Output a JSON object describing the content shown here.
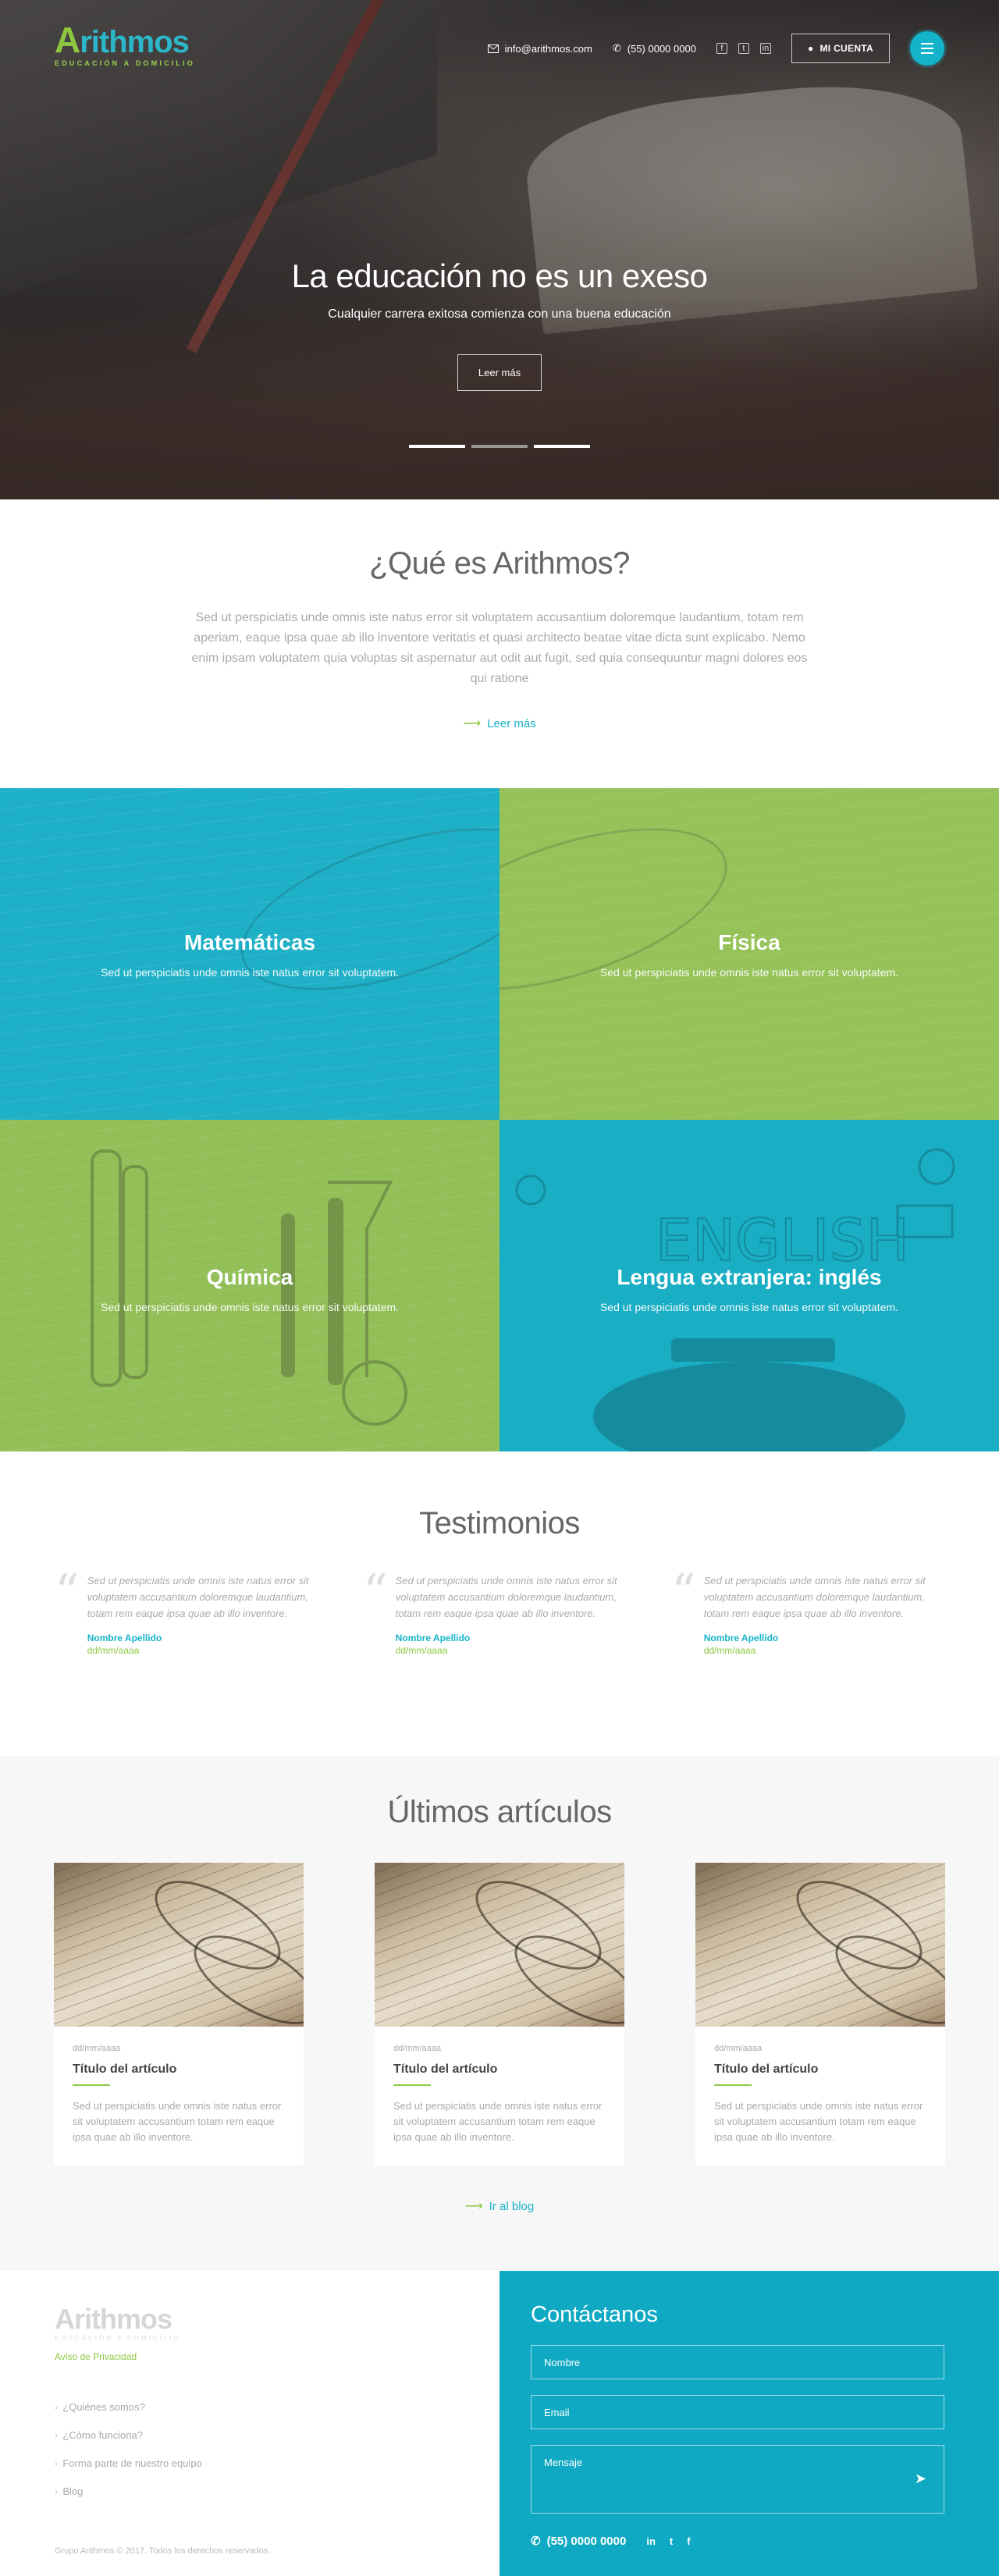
{
  "brand": {
    "logo_letter": "A",
    "logo_rest": "rithmos",
    "tagline": "EDUCACIÓN A DOMICILIO",
    "accent_teal": "#15b3c9",
    "accent_green": "#8dc63f"
  },
  "nav": {
    "email": "info@arithmos.com",
    "phone": "(55) 0000 0000",
    "account_label": "MI CUENTA",
    "social_icons": [
      "facebook-icon",
      "twitter-icon",
      "linkedin-icon"
    ]
  },
  "hero": {
    "title": "La educación no es un exeso",
    "subtitle": "Cualquier carrera exitosa comienza con una buena educación",
    "button_label": "Leer más",
    "slides_total": 3,
    "active_slide": 1
  },
  "about": {
    "title": "¿Qué es Arithmos?",
    "text": "Sed ut perspiciatis unde omnis iste natus error sit voluptatem accusantium doloremque laudantium, totam rem aperiam, eaque ipsa quae ab illo inventore veritatis et quasi architecto beatae vitae dicta sunt explicabo. Nemo enim ipsam voluptatem quia voluptas sit aspernatur aut odit aut fugit, sed quia consequuntur magni dolores eos qui ratione",
    "link_label": "Leer más"
  },
  "subjects": [
    {
      "title": "Matemáticas",
      "desc": "Sed ut perspiciatis unde omnis iste natus error sit voluptatem.",
      "color": "#1db0c7"
    },
    {
      "title": "Física",
      "desc": "Sed ut perspiciatis unde omnis iste natus error sit voluptatem.",
      "color": "#95c259"
    },
    {
      "title": "Química",
      "desc": "Sed ut perspiciatis unde omnis iste natus error sit voluptatem.",
      "color": "#95c259"
    },
    {
      "title": "Lengua extranjera: inglés",
      "desc": "Sed ut perspiciatis unde omnis iste natus error sit voluptatem.",
      "color": "#1db0c7"
    }
  ],
  "testimonials": {
    "title": "Testimonios",
    "items": [
      {
        "text": "Sed ut perspiciatis unde omnis iste natus error sit voluptatem accusantium doloremque laudantium, totam rem eaque ipsa quae ab illo inventore.",
        "name": "Nombre Apellido",
        "date": "dd/mm/aaaa"
      },
      {
        "text": "Sed ut perspiciatis unde omnis iste natus error sit voluptatem accusantium doloremque laudantium, totam rem eaque ipsa quae ab illo inventore.",
        "name": "Nombre Apellido",
        "date": "dd/mm/aaaa"
      },
      {
        "text": "Sed ut perspiciatis unde omnis iste natus error sit voluptatem accusantium doloremque laudantium, totam rem eaque ipsa quae ab illo inventore.",
        "name": "Nombre Apellido",
        "date": "dd/mm/aaaa"
      }
    ]
  },
  "articles": {
    "title": "Últimos artículos",
    "items": [
      {
        "date": "dd/mm/aaaa",
        "title": "Título del artículo",
        "text": "Sed ut perspiciatis unde omnis iste natus error sit voluptatem accusantium totam rem eaque ipsa quae ab illo inventore."
      },
      {
        "date": "dd/mm/aaaa",
        "title": "Título del artículo",
        "text": "Sed ut perspiciatis unde omnis iste natus error sit voluptatem accusantium totam rem eaque ipsa quae ab illo inventore."
      },
      {
        "date": "dd/mm/aaaa",
        "title": "Título del artículo",
        "text": "Sed ut perspiciatis unde omnis iste natus error sit voluptatem accusantium totam rem eaque ipsa quae ab illo inventore."
      }
    ],
    "blog_link": "Ir al blog"
  },
  "footer": {
    "logo": "Arithmos",
    "tagline": "EDUCACIÓN A DOMICILIO",
    "privacy": "Aviso de Privacidad",
    "links": [
      "¿Quiénes somos?",
      "¿Cómo funciona?",
      "Forma parte de nuestro equipo",
      "Blog"
    ],
    "copyright": "Grupo Arithmos © 2017. Todos los derechos reservados.",
    "contact": {
      "title": "Contáctanos",
      "name_placeholder": "Nombre",
      "email_placeholder": "Email",
      "message_placeholder": "Mensaje",
      "phone": "(55) 0000 0000",
      "social_icons": [
        "linkedin-icon",
        "twitter-icon",
        "facebook-icon"
      ]
    }
  }
}
